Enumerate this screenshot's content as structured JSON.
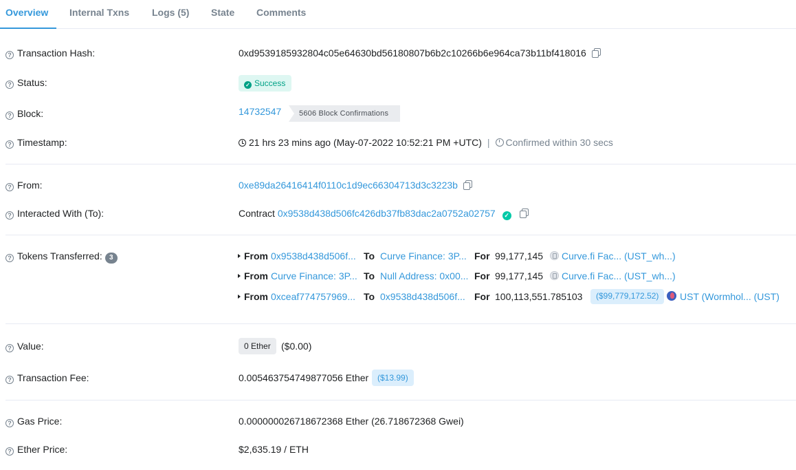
{
  "tabs": [
    {
      "label": "Overview",
      "active": true
    },
    {
      "label": "Internal Txns",
      "active": false
    },
    {
      "label": "Logs (5)",
      "active": false
    },
    {
      "label": "State",
      "active": false
    },
    {
      "label": "Comments",
      "active": false
    }
  ],
  "colors": {
    "accent": "#3498db",
    "success": "#00a186",
    "text": "#1e2022",
    "muted": "#77838f"
  },
  "tx_hash": {
    "label": "Transaction Hash:",
    "value": "0xd9539185932804c05e64630bd56180807b6b2c10266b6e964ca73b11bf418016"
  },
  "status": {
    "label": "Status:",
    "value": "Success"
  },
  "block": {
    "label": "Block:",
    "number": "14732547",
    "confirmations": "5606 Block Confirmations"
  },
  "timestamp": {
    "label": "Timestamp:",
    "value": "21 hrs 23 mins ago (May-07-2022 10:52:21 PM +UTC)",
    "separator": "|",
    "confirmed": "Confirmed within 30 secs"
  },
  "from": {
    "label": "From:",
    "address": "0xe89da26416414f0110c1d9ec66304713d3c3223b"
  },
  "to": {
    "label": "Interacted With (To):",
    "prefix": "Contract",
    "address": "0x9538d438d506fc426db37fb83dac2a0752a02757"
  },
  "tokens": {
    "label": "Tokens Transferred:",
    "count": "3",
    "from_kw": "From",
    "to_kw": "To",
    "for_kw": "For",
    "transfers": [
      {
        "from": "0x9538d438d506f...",
        "to": "Curve Finance: 3P...",
        "amount": "99,177,145",
        "usd": "",
        "token": "Curve.fi Fac... (UST_wh...)",
        "icon": "curve-token-icon"
      },
      {
        "from": "Curve Finance: 3P...",
        "to": "Null Address: 0x00...",
        "amount": "99,177,145",
        "usd": "",
        "token": "Curve.fi Fac... (UST_wh...)",
        "icon": "curve-token-icon"
      },
      {
        "from": "0xceaf774757969...",
        "to": "0x9538d438d506f...",
        "amount": "100,113,551.785103",
        "usd": "($99,779,172.52)",
        "token": "UST (Wormhol... (UST)",
        "icon": "ust-token-icon"
      }
    ]
  },
  "value": {
    "label": "Value:",
    "ether": "0 Ether",
    "usd": "($0.00)"
  },
  "fee": {
    "label": "Transaction Fee:",
    "value": "0.005463754749877056 Ether",
    "usd": "($13.99)"
  },
  "gas_price": {
    "label": "Gas Price:",
    "value": "0.000000026718672368 Ether (26.718672368 Gwei)"
  },
  "ether_price": {
    "label": "Ether Price:",
    "value": "$2,635.19 / ETH"
  }
}
